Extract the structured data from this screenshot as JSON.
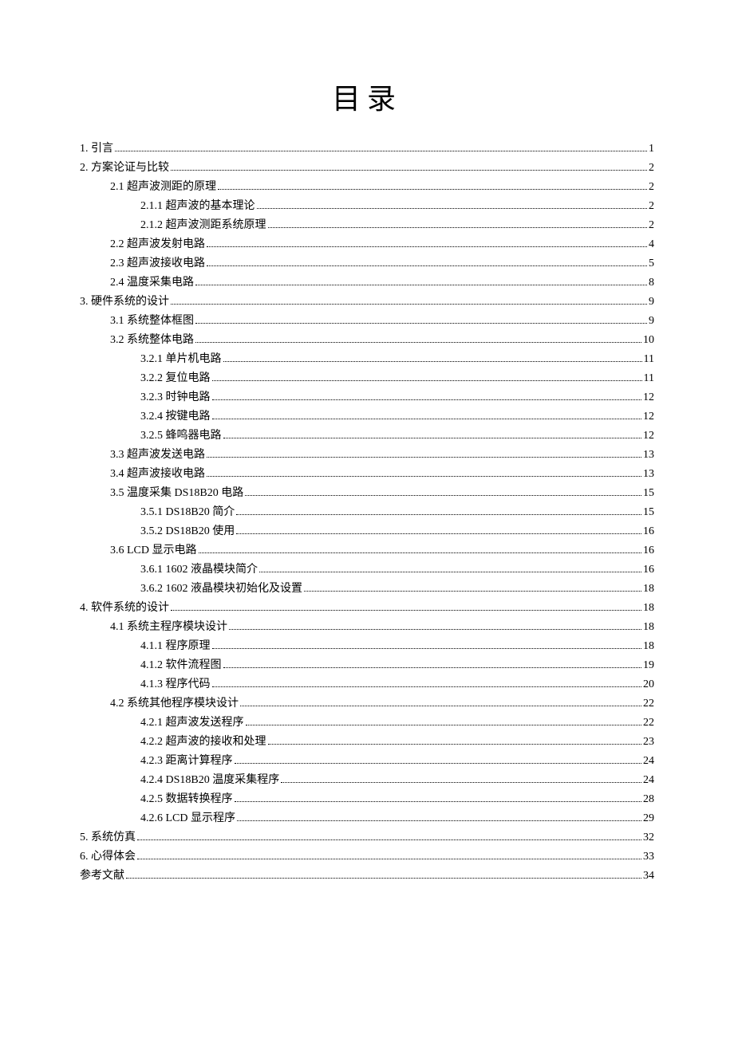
{
  "title": "目录",
  "toc": [
    {
      "level": 0,
      "label": "1. 引言",
      "page": "1"
    },
    {
      "level": 0,
      "label": "2. 方案论证与比较",
      "page": "2"
    },
    {
      "level": 1,
      "label": "2.1 超声波测距的原理",
      "page": "2"
    },
    {
      "level": 2,
      "label": "2.1.1 超声波的基本理论",
      "page": "2"
    },
    {
      "level": 2,
      "label": "2.1.2 超声波测距系统原理",
      "page": "2"
    },
    {
      "level": 1,
      "label": "2.2 超声波发射电路",
      "page": "4"
    },
    {
      "level": 1,
      "label": "2.3 超声波接收电路",
      "page": "5"
    },
    {
      "level": 1,
      "label": "2.4 温度采集电路",
      "page": "8"
    },
    {
      "level": 0,
      "label": "3. 硬件系统的设计",
      "page": "9"
    },
    {
      "level": 1,
      "label": "3.1 系统整体框图",
      "page": "9"
    },
    {
      "level": 1,
      "label": "3.2 系统整体电路",
      "page": "10"
    },
    {
      "level": 2,
      "label": "3.2.1 单片机电路",
      "page": "11"
    },
    {
      "level": 2,
      "label": "3.2.2 复位电路",
      "page": "11"
    },
    {
      "level": 2,
      "label": "3.2.3 时钟电路",
      "page": "12"
    },
    {
      "level": 2,
      "label": "3.2.4 按键电路",
      "page": "12"
    },
    {
      "level": 2,
      "label": "3.2.5 蜂鸣器电路",
      "page": "12"
    },
    {
      "level": 1,
      "label": "3.3 超声波发送电路",
      "page": "13"
    },
    {
      "level": 1,
      "label": "3.4 超声波接收电路",
      "page": "13"
    },
    {
      "level": 1,
      "label": "3.5 温度采集 DS18B20 电路",
      "page": "15"
    },
    {
      "level": 2,
      "label": "3.5.1 DS18B20 简介",
      "page": "15"
    },
    {
      "level": 2,
      "label": "3.5.2 DS18B20 使用",
      "page": "16"
    },
    {
      "level": 1,
      "label": "3.6 LCD 显示电路",
      "page": "16"
    },
    {
      "level": 2,
      "label": "3.6.1 1602 液晶模块简介",
      "page": "16"
    },
    {
      "level": 2,
      "label": "3.6.2 1602 液晶模块初始化及设置",
      "page": "18"
    },
    {
      "level": 0,
      "label": "4. 软件系统的设计",
      "page": "18"
    },
    {
      "level": 1,
      "label": "4.1 系统主程序模块设计",
      "page": "18"
    },
    {
      "level": 2,
      "label": "4.1.1 程序原理",
      "page": "18"
    },
    {
      "level": 2,
      "label": "4.1.2 软件流程图",
      "page": "19"
    },
    {
      "level": 2,
      "label": "4.1.3 程序代码",
      "page": "20"
    },
    {
      "level": 1,
      "label": "4.2 系统其他程序模块设计",
      "page": "22"
    },
    {
      "level": 2,
      "label": "4.2.1 超声波发送程序",
      "page": "22"
    },
    {
      "level": 2,
      "label": "4.2.2 超声波的接收和处理",
      "page": "23"
    },
    {
      "level": 2,
      "label": "4.2.3 距离计算程序",
      "page": "24"
    },
    {
      "level": 2,
      "label": "4.2.4 DS18B20 温度采集程序",
      "page": "24"
    },
    {
      "level": 2,
      "label": "4.2.5 数据转换程序",
      "page": "28"
    },
    {
      "level": 2,
      "label": "4.2.6 LCD 显示程序",
      "page": "29"
    },
    {
      "level": 0,
      "label": "5. 系统仿真",
      "page": "32"
    },
    {
      "level": 0,
      "label": "6. 心得体会",
      "page": "33"
    },
    {
      "level": 0,
      "label": "参考文献",
      "page": "34"
    }
  ]
}
